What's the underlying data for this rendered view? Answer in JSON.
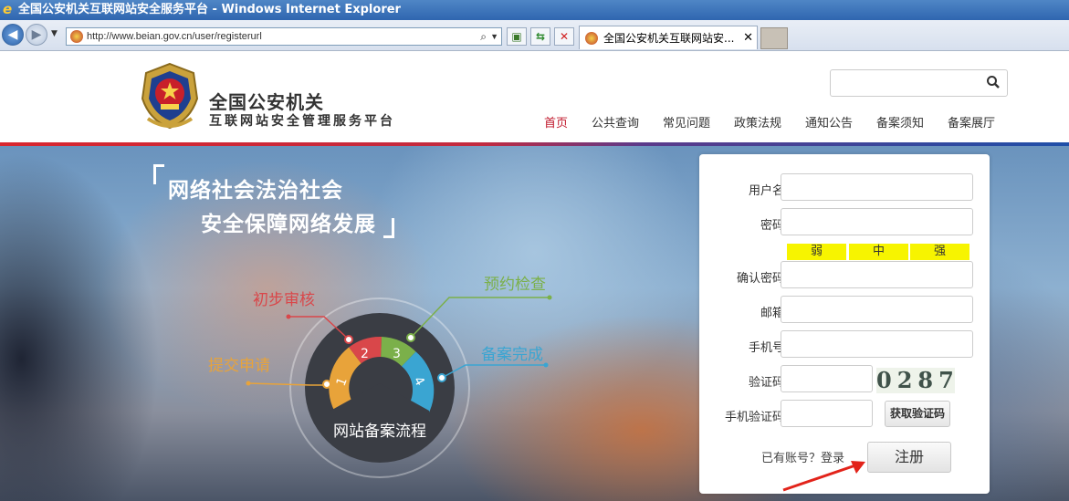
{
  "window": {
    "title": "全国公安机关互联网站安全服务平台 - Windows Internet Explorer"
  },
  "browser": {
    "url": "http://www.beian.gov.cn/user/registerurl",
    "tab_title": "全国公安机关互联网站安...",
    "tab_close": "✕"
  },
  "site": {
    "brand_line1": "全国公安机关",
    "brand_line2": "互联网站安全管理服务平台",
    "nav": [
      "首页",
      "公共查询",
      "常见问题",
      "政策法规",
      "通知公告",
      "备案须知",
      "备案展厅"
    ],
    "active_nav": "首页",
    "search": {
      "value": ""
    }
  },
  "hero": {
    "slogan_line1": "网络社会法治社会",
    "slogan_line2": "安全保障网络发展",
    "process": {
      "title": "网站备案流程",
      "steps": [
        {
          "num": "1",
          "label": "提交申请",
          "color": "#e8a33a"
        },
        {
          "num": "2",
          "label": "初步审核",
          "color": "#d9474a"
        },
        {
          "num": "3",
          "label": "预约检查",
          "color": "#7bb04a"
        },
        {
          "num": "4",
          "label": "备案完成",
          "color": "#3aa5d2"
        }
      ]
    }
  },
  "form": {
    "username_label": "用户名",
    "password_label": "密码",
    "strength": [
      "弱",
      "中",
      "强"
    ],
    "confirm_label": "确认密码",
    "email_label": "邮箱",
    "phone_label": "手机号",
    "captcha_label": "验证码",
    "captcha_text": "0287",
    "sms_label": "手机验证码",
    "sms_button": "获取验证码",
    "have_account": "已有账号？",
    "login_link": "登录",
    "register_button": "注册"
  },
  "colors": {
    "brand_red": "#c0172b",
    "strength_yellow": "#f7f400",
    "annotation_arrow": "#e2231a"
  }
}
